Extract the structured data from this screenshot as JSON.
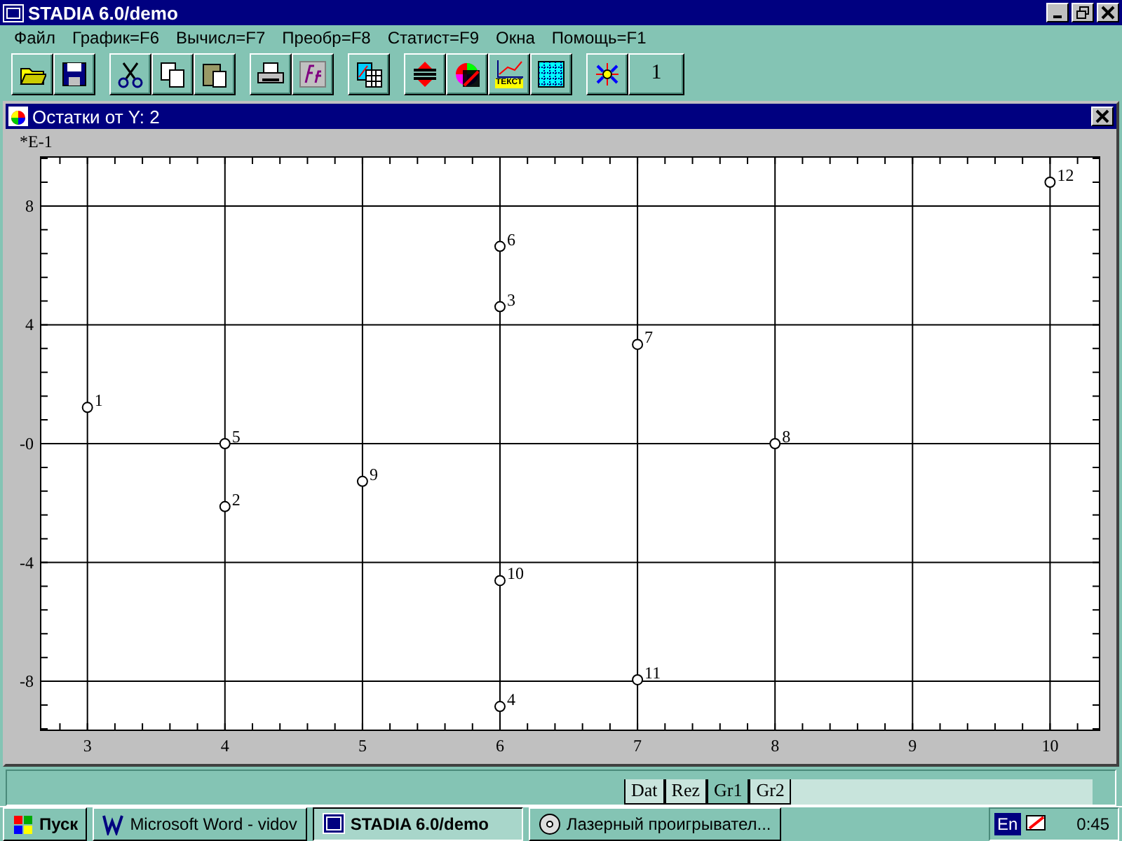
{
  "window": {
    "title": "STADIA 6.0/demo"
  },
  "menu": [
    {
      "label": "Файл"
    },
    {
      "label": "График=F6"
    },
    {
      "label": "Вычисл=F7"
    },
    {
      "label": "Преобр=F8"
    },
    {
      "label": "Статист=F9"
    },
    {
      "label": "Окна"
    },
    {
      "label": "Помощь=F1"
    }
  ],
  "toolbar": [
    [
      {
        "kind": "open"
      },
      {
        "kind": "save"
      }
    ],
    [
      {
        "kind": "cut"
      },
      {
        "kind": "copy"
      },
      {
        "kind": "paste"
      }
    ],
    [
      {
        "kind": "print"
      },
      {
        "kind": "formula"
      }
    ],
    [
      {
        "kind": "table"
      }
    ],
    [
      {
        "kind": "sort"
      },
      {
        "kind": "colors"
      },
      {
        "kind": "chart",
        "label": "ТЕКСТ"
      },
      {
        "kind": "grid"
      }
    ],
    [
      {
        "kind": "scatter"
      },
      {
        "kind": "number",
        "label": "1"
      }
    ]
  ],
  "child_window": {
    "title": "Остатки от Y: 2",
    "chart_data": {
      "type": "scatter",
      "ylabel": "*E-1",
      "x": [
        3,
        4,
        6,
        6,
        4,
        6,
        7,
        8,
        5,
        6,
        7,
        10
      ],
      "series": [
        {
          "values": [
            1.22,
            -2.12,
            4.61,
            -8.85,
            0,
            6.64,
            3.34,
            0,
            -1.27,
            -4.61,
            -7.95,
            8.8
          ]
        }
      ],
      "value_labels": [
        "1",
        "2",
        "3",
        "4",
        "5",
        "6",
        "7",
        "8",
        "9",
        "10",
        "11",
        "12"
      ],
      "xlim": [
        2.66,
        10.36
      ],
      "ylim": [
        -9.65,
        9.65
      ],
      "xticks": [
        3,
        4,
        5,
        6,
        7,
        8,
        9,
        10
      ],
      "yticks": [
        -8,
        -4,
        {
          "value": 0,
          "label": "-0"
        },
        4,
        8
      ],
      "grid": true
    }
  },
  "sheet_tabs": [
    {
      "label": "Dat",
      "selected": false
    },
    {
      "label": "Rez",
      "selected": false
    },
    {
      "label": "Gr1",
      "selected": true
    },
    {
      "label": "Gr2",
      "selected": false
    }
  ],
  "taskbar": {
    "start": "Пуск",
    "tasks": [
      {
        "kind": "word",
        "label": "Microsoft Word - vidov",
        "selected": false
      },
      {
        "kind": "stadia",
        "label": "STADIA 6.0/demo",
        "selected": true
      },
      {
        "kind": "cd",
        "label": "Лазерный проигрывател...",
        "selected": false
      }
    ],
    "language": "En",
    "clock": "0:45"
  }
}
